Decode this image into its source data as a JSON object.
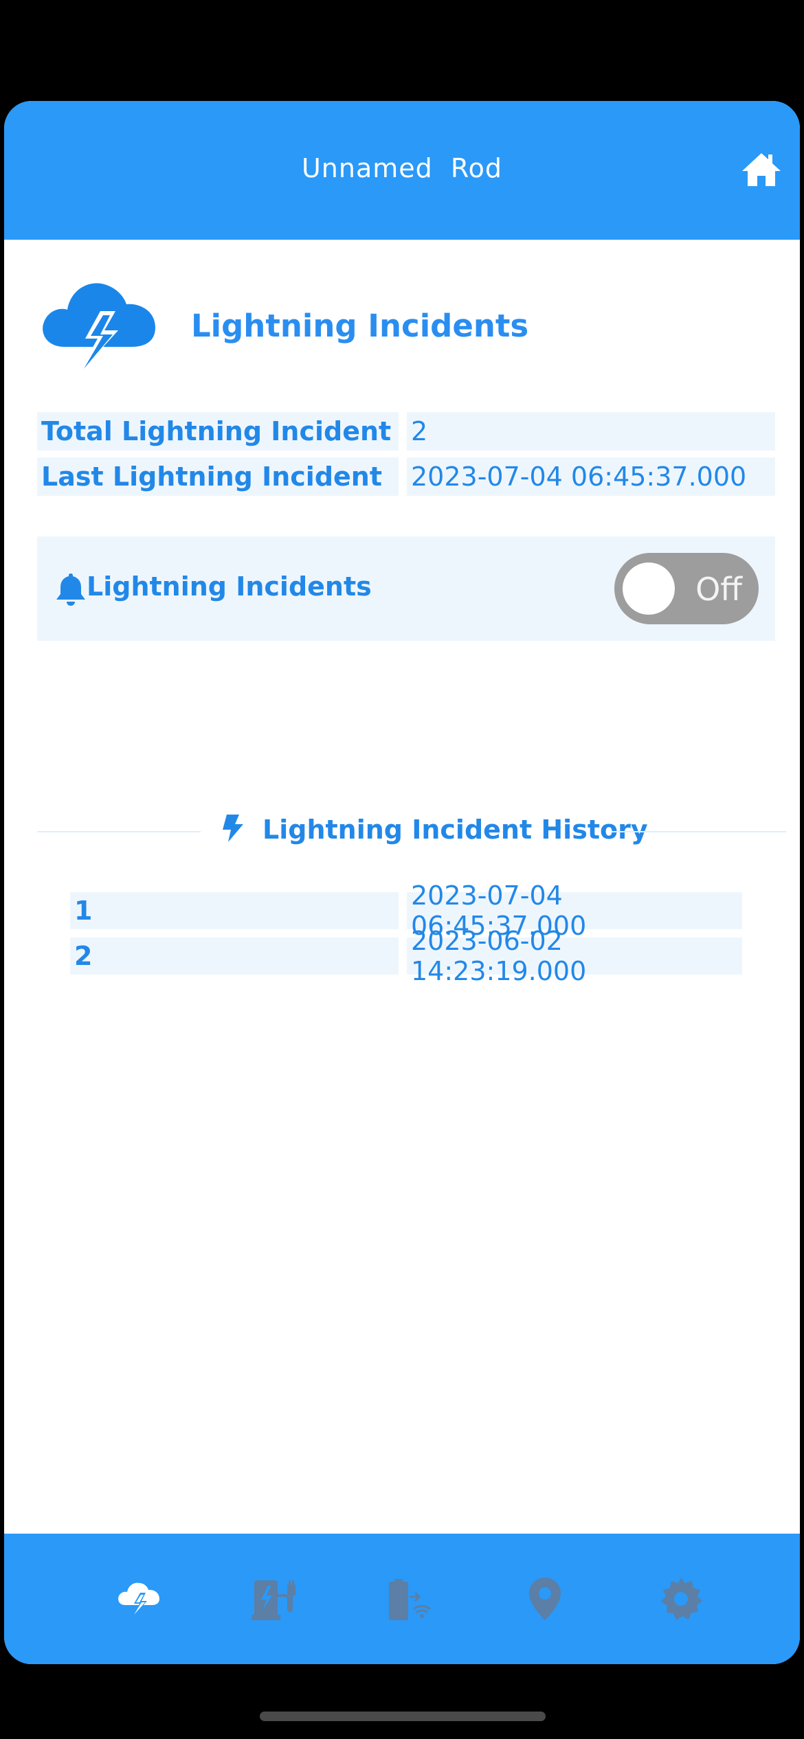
{
  "header": {
    "title": "Unnamed  Rod",
    "home_icon": "home-icon"
  },
  "section": {
    "icon": "storm-cloud-icon",
    "title": "Lightning Incidents"
  },
  "summary": [
    {
      "label": "Total Lightning Incident",
      "value": "2"
    },
    {
      "label": "Last Lightning Incident",
      "value": "2023-07-04 06:45:37.000"
    }
  ],
  "alert": {
    "icon": "bell-icon",
    "label": "Lightning Incidents",
    "toggle_text": "Off",
    "enabled": false
  },
  "history": {
    "icon": "bolt-icon",
    "title": "Lightning Incident History",
    "rows": [
      {
        "index": "1",
        "date": "2023-07-04 06:45:37.000"
      },
      {
        "index": "2",
        "date": "2023-06-02 14:23:19.000"
      }
    ]
  },
  "bottom_nav": {
    "items": [
      {
        "icon": "lightning-cloud-icon",
        "active": true
      },
      {
        "icon": "charging-station-icon",
        "active": false
      },
      {
        "icon": "battery-wifi-icon",
        "active": false
      },
      {
        "icon": "location-pin-icon",
        "active": false
      },
      {
        "icon": "settings-gear-icon",
        "active": false
      }
    ]
  },
  "colors": {
    "primary": "#2a99f8",
    "text_blue": "#2288e8",
    "row_bg": "#eef6fd",
    "toggle_off": "#9d9d9d",
    "nav_inactive": "#5b7fa6",
    "nav_active": "#ffffff"
  }
}
